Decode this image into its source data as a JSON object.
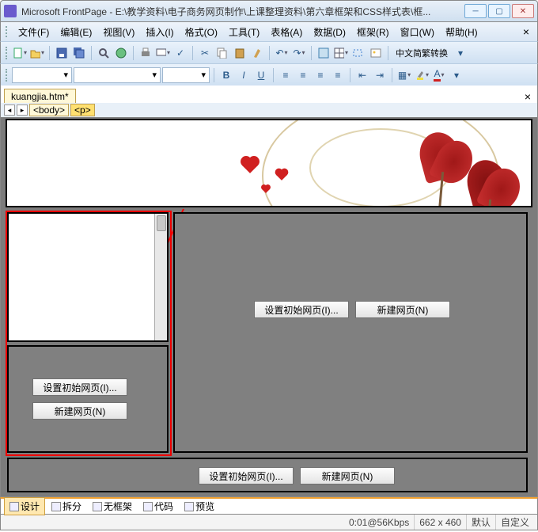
{
  "window": {
    "title": "Microsoft FrontPage - E:\\教学资料\\电子商务网页制作\\上课整理资料\\第六章框架和CSS样式表\\框..."
  },
  "menu": {
    "file": "文件(F)",
    "edit": "编辑(E)",
    "view": "视图(V)",
    "insert": "插入(I)",
    "format": "格式(O)",
    "tools": "工具(T)",
    "table": "表格(A)",
    "data": "数据(D)",
    "frame": "框架(R)",
    "window": "窗口(W)",
    "help": "帮助(H)"
  },
  "toolbar": {
    "cn_convert": "中文简繁转换"
  },
  "tabs": {
    "file1": "kuangjia.htm*"
  },
  "breadcrumb": {
    "body": "<body>",
    "p": "<p>"
  },
  "frame": {
    "set_initial": "设置初始网页(I)...",
    "new_page": "新建网页(N)"
  },
  "viewtabs": {
    "design": "设计",
    "split": "拆分",
    "noframes": "无框架",
    "code": "代码",
    "preview": "预览"
  },
  "status": {
    "time": "0:01@56Kbps",
    "size": "662 x 460",
    "mode": "默认",
    "custom": "自定义"
  }
}
